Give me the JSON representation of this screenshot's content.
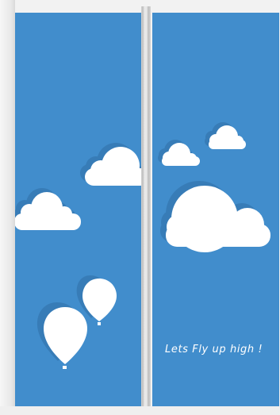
{
  "caption": {
    "text": "Lets Fly up high !"
  },
  "colors": {
    "sky": "#418dcc",
    "cloud": "#ffffff",
    "shadow": "#2f6fa6",
    "frame": "#f2f2f2"
  }
}
